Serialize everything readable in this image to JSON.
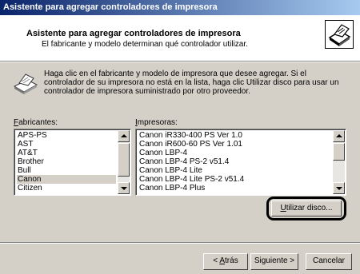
{
  "window": {
    "title": "Asistente para agregar controladores de impresora"
  },
  "header": {
    "title": "Asistente para agregar controladores de impresora",
    "subtitle": "El fabricante y modelo determinan qué controlador utilizar.",
    "icon": "printer-icon"
  },
  "instructions": {
    "icon": "printer-icon",
    "text": "Haga clic en el fabricante y modelo de impresora que desee agregar. Si el controlador de su impresora no está en la lista, haga clic Utilizar disco para usar un controlador de impresora suministrado por otro proveedor."
  },
  "manufacturers": {
    "label_pre": "",
    "label_key": "F",
    "label_post": "abricantes:",
    "items": [
      "APS-PS",
      "AST",
      "AT&T",
      "Brother",
      "Bull",
      "Canon",
      "Citizen"
    ],
    "selected": "Canon"
  },
  "printers": {
    "label_pre": "",
    "label_key": "I",
    "label_post": "mpresoras:",
    "items": [
      "Canon iR330-400 PS Ver 1.0",
      "Canon iR600-60 PS Ver 1.01",
      "Canon LBP-4",
      "Canon LBP-4 PS-2 v51.4",
      "Canon LBP-4 Lite",
      "Canon LBP-4 Lite PS-2 v51.4",
      "Canon LBP-4 Plus"
    ]
  },
  "buttons": {
    "have_disk_key": "U",
    "have_disk_rest": "tilizar disco...",
    "back_pre": "< ",
    "back_key": "A",
    "back_rest": "trás",
    "next": "Siguiente >",
    "cancel": "Cancelar"
  }
}
